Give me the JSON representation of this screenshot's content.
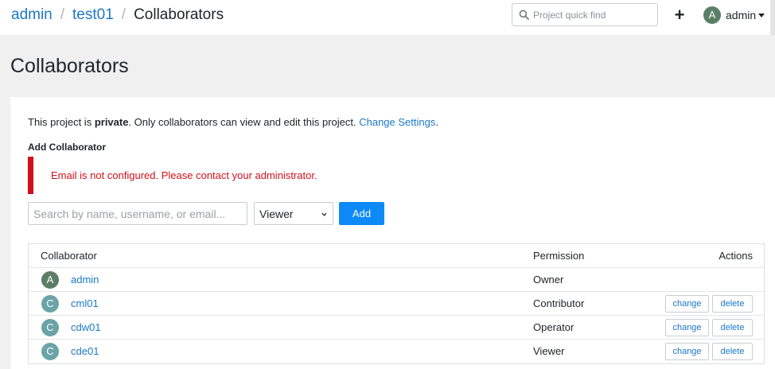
{
  "colors": {
    "link": "#1b78c8",
    "primary_button": "#0d8af8",
    "error": "#d0101a",
    "avatar_owner": "#5b7f66",
    "avatar_member": "#6aa3a8"
  },
  "breadcrumb": {
    "items": [
      "admin",
      "test01"
    ],
    "current": "Collaborators"
  },
  "header": {
    "quick_find_placeholder": "Project quick find",
    "user_initial": "A",
    "user_name": "admin"
  },
  "page": {
    "title": "Collaborators"
  },
  "privacy": {
    "prefix": "This project is ",
    "status": "private",
    "middle": ". Only collaborators can view and edit this project. ",
    "link": "Change Settings",
    "suffix": "."
  },
  "add_collaborator": {
    "heading": "Add Collaborator",
    "alert": "Email is not configured. Please contact your administrator.",
    "search_placeholder": "Search by name, username, or email...",
    "permission_selected": "Viewer",
    "add_label": "Add"
  },
  "table": {
    "headers": {
      "collaborator": "Collaborator",
      "permission": "Permission",
      "actions": "Actions"
    },
    "change_label": "change",
    "delete_label": "delete",
    "rows": [
      {
        "initial": "A",
        "name": "admin",
        "permission": "Owner",
        "owner": true
      },
      {
        "initial": "C",
        "name": "cml01",
        "permission": "Contributor",
        "owner": false
      },
      {
        "initial": "C",
        "name": "cdw01",
        "permission": "Operator",
        "owner": false
      },
      {
        "initial": "C",
        "name": "cde01",
        "permission": "Viewer",
        "owner": false
      }
    ]
  }
}
